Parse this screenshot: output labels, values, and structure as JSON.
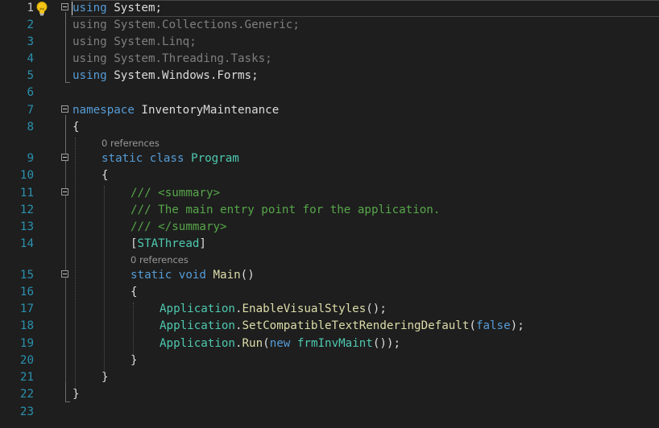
{
  "editor": {
    "line_numbers": [
      "1",
      "2",
      "3",
      "4",
      "5",
      "6",
      "7",
      "8",
      "9",
      "10",
      "11",
      "12",
      "13",
      "14",
      "15",
      "16",
      "17",
      "18",
      "19",
      "20",
      "21",
      "22",
      "23"
    ],
    "codelens": {
      "program_refs": "0 references",
      "main_refs": "0 references"
    },
    "lines": {
      "l1": {
        "kw": "using",
        "rest": " System;"
      },
      "l2": {
        "kw": "using",
        "rest": " System.Collections.Generic;"
      },
      "l3": {
        "kw": "using",
        "rest": " System.Linq;"
      },
      "l4": {
        "kw": "using",
        "rest": " System.Threading.Tasks;"
      },
      "l5": {
        "kw": "using",
        "rest": " System.Windows.Forms;"
      },
      "l7": {
        "kw": "namespace",
        "rest": " InventoryMaintenance"
      },
      "l8": {
        "text": "{"
      },
      "l9": {
        "kw1": "static",
        "kw2": " class ",
        "type": "Program"
      },
      "l10": {
        "text": "{"
      },
      "l11": {
        "c1": "/// ",
        "c2": "<summary>"
      },
      "l12": {
        "c1": "/// The main entry point for the application."
      },
      "l13": {
        "c1": "/// ",
        "c2": "</summary>"
      },
      "l14": {
        "open": "[",
        "type": "STAThread",
        "close": "]"
      },
      "l15": {
        "kw1": "static",
        "kw2": " void ",
        "name": "Main",
        "rest": "()"
      },
      "l16": {
        "text": "{"
      },
      "l17": {
        "type": "Application",
        "dot": ".",
        "method": "EnableVisualStyles",
        "rest": "();"
      },
      "l18": {
        "type": "Application",
        "dot": ".",
        "method": "SetCompatibleTextRenderingDefault",
        "open": "(",
        "kw": "false",
        "rest": ");"
      },
      "l19": {
        "type": "Application",
        "dot": ".",
        "method": "Run",
        "open": "(",
        "kw": "new",
        "sp": " ",
        "type2": "frmInvMaint",
        "rest": "());"
      },
      "l20": {
        "text": "}"
      },
      "l21": {
        "text": "}"
      },
      "l22": {
        "text": "}"
      }
    }
  },
  "colors": {
    "background": "#1e1e1e",
    "line_number": "#2b91af",
    "keyword": "#569cd6",
    "type": "#4ec9b0",
    "comment": "#57a64a",
    "text": "#dcdcdc"
  },
  "icons": [
    "lightbulb-icon",
    "collapse-icon"
  ]
}
